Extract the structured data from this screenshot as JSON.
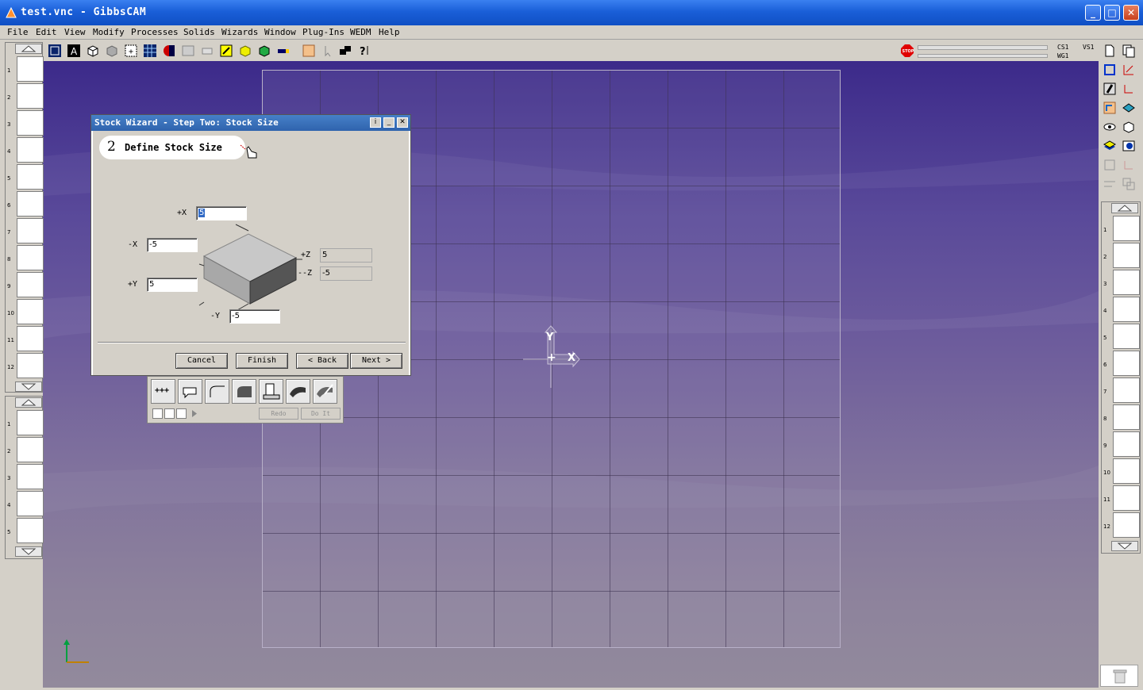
{
  "window": {
    "title": "test.vnc - GibbsCAM",
    "minimize_glyph": "_",
    "maximize_glyph": "□",
    "close_glyph": "✕"
  },
  "menu": [
    "File",
    "Edit",
    "View",
    "Modify",
    "Processes",
    "Solids",
    "Wizards",
    "Window",
    "Plug-Ins",
    "WEDM",
    "Help"
  ],
  "toolbar": {
    "cs_label": "CS1",
    "wg_label": "WG1",
    "vs_label": "VS1",
    "stop_label": "STOP"
  },
  "left_panel": {
    "group1_numbers": [
      "1",
      "2",
      "3",
      "4",
      "5",
      "6",
      "7",
      "8",
      "9",
      "10",
      "11",
      "12"
    ],
    "group2_numbers": [
      "1",
      "2",
      "3",
      "4",
      "5"
    ]
  },
  "right_panel": {
    "numbers": [
      "1",
      "2",
      "3",
      "4",
      "5",
      "6",
      "7",
      "8",
      "9",
      "10",
      "11",
      "12"
    ]
  },
  "viewport": {
    "axis_y": "Y",
    "axis_x": "X",
    "origin": "+"
  },
  "dialog": {
    "title": "Stock Wizard - Step Two: Stock Size",
    "step_number": "2",
    "step_title": "Define Stock Size",
    "labels": {
      "plus_x": "+X",
      "minus_x": "-X",
      "plus_y": "+Y",
      "minus_y": "-Y",
      "plus_z": "+Z",
      "minus_z": "--Z"
    },
    "values": {
      "plus_x": "5",
      "minus_x": "-5",
      "plus_y": "5",
      "minus_y": "-5",
      "plus_z": "5",
      "minus_z": "-5"
    },
    "buttons": {
      "cancel": "Cancel",
      "finish": "Finish",
      "back": "< Back",
      "next": "Next >"
    }
  },
  "palette": {
    "redo": "Redo",
    "do_it": "Do It",
    "points_glyph": "+++"
  },
  "colors": {
    "title_bar": "#1a5fd8",
    "dialog_title": "#2f63ad",
    "viewport_top": "#3c2a8a",
    "viewport_bottom": "#928a9c"
  }
}
